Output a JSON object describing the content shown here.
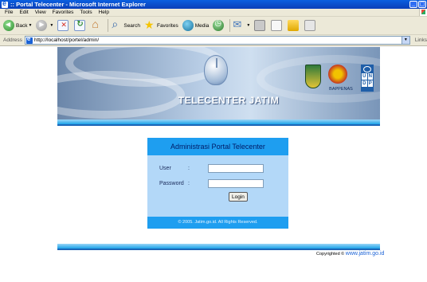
{
  "window": {
    "title": ":: Portal Telecenter - Microsoft Internet Explorer",
    "minimize": "_",
    "maximize": "▢"
  },
  "menu": [
    "File",
    "Edit",
    "View",
    "Favorites",
    "Tools",
    "Help"
  ],
  "toolbar": {
    "back": "Back",
    "search": "Search",
    "favorites": "Favorites",
    "media": "Media"
  },
  "address": {
    "label": "Address",
    "url": "http://localhost/portel/admin/",
    "links": "Links"
  },
  "banner": {
    "title": "TELECENTER JATIM",
    "bappenas": "BAPPENAS",
    "undp_letters": [
      "U",
      "N",
      "D",
      "P"
    ]
  },
  "login": {
    "heading": "Administrasi Portal Telecenter",
    "user_label": "User",
    "password_label": "Password",
    "colon": ":",
    "user_value": "",
    "password_value": "",
    "button": "Login",
    "footer": "© 2005. Jatim.go.id. All Rights Reserved."
  },
  "footer": {
    "copyright_prefix": "Copyrighted ©",
    "site": "www.jatim.go.id"
  }
}
